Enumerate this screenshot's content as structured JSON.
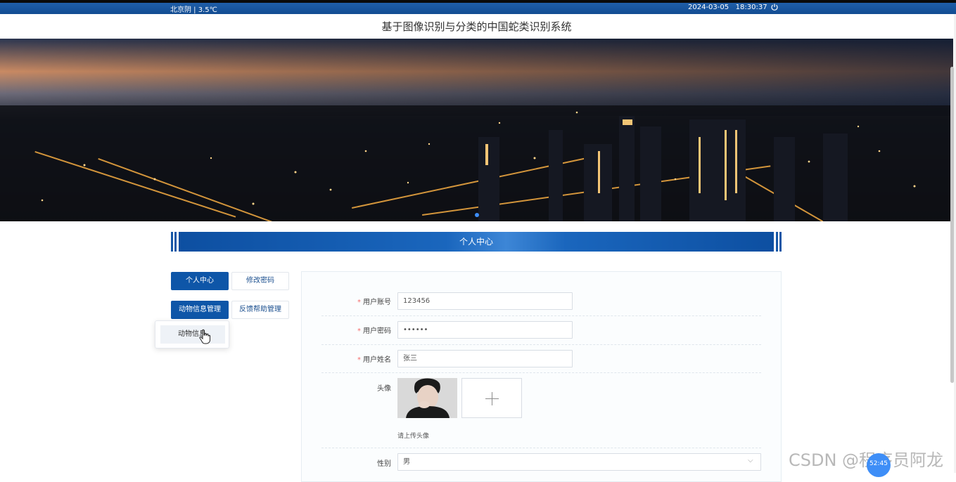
{
  "topbar": {
    "weather": "北京阴 | 3.5℃",
    "datetime": "2024-03-05   18:30:37",
    "power_icon": "power-icon"
  },
  "site_title": "基于图像识别与分类的中国蛇类识别系统",
  "section_title": "个人中心",
  "menu": {
    "profile": "个人中心",
    "change_password": "修改密码",
    "animal_info_mgmt": "动物信息管理",
    "feedback_mgmt": "反馈帮助管理",
    "dropdown_item": "动物信息"
  },
  "form": {
    "account_label": "用户账号",
    "account_value": "123456",
    "password_label": "用户密码",
    "password_value": "••••••",
    "name_label": "用户姓名",
    "name_value": "张三",
    "avatar_label": "头像",
    "avatar_hint": "请上传头像",
    "gender_label": "性别",
    "gender_value": "男"
  },
  "watermark": "CSDN @程序员阿龙",
  "float_badge": "52:45",
  "colors": {
    "primary": "#0e56a8",
    "required": "#f56c6c"
  }
}
